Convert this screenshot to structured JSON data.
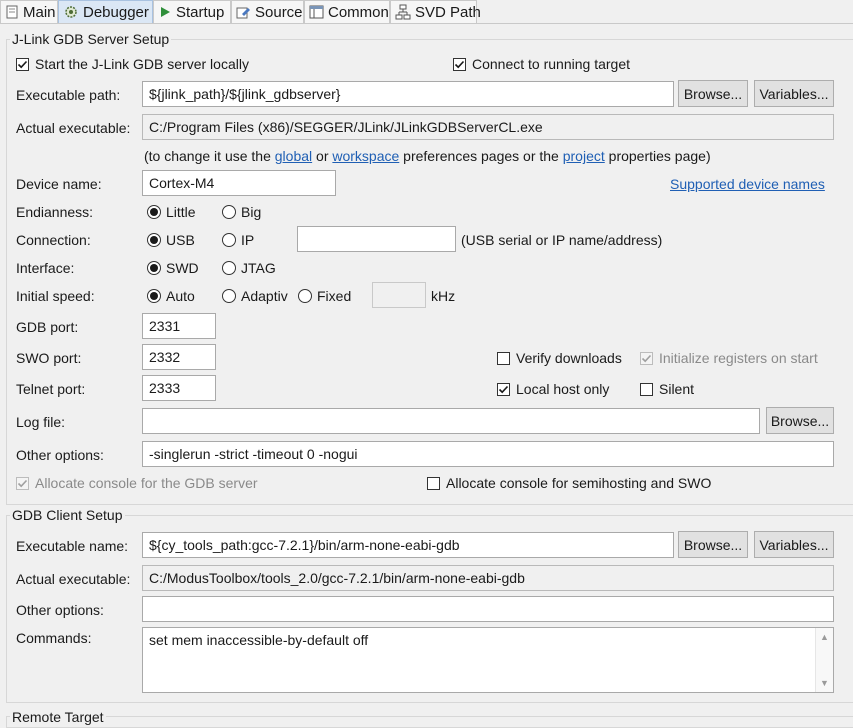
{
  "tabs": [
    {
      "label": "Main",
      "icon": "main-tab-icon",
      "active": false
    },
    {
      "label": "Debugger",
      "icon": "bug-gear-icon",
      "active": true
    },
    {
      "label": "Startup",
      "icon": "play-icon",
      "active": false
    },
    {
      "label": "Source",
      "icon": "source-icon",
      "active": false
    },
    {
      "label": "Common",
      "icon": "common-icon",
      "active": false
    },
    {
      "label": "SVD Path",
      "icon": "svd-icon",
      "active": false
    }
  ],
  "jlink": {
    "title": "J-Link GDB Server Setup",
    "start_locally": {
      "label": "Start the J-Link GDB server locally",
      "checked": true
    },
    "connect_running": {
      "label": "Connect to running target",
      "checked": true
    },
    "exec_path_label": "Executable path:",
    "exec_path_value": "${jlink_path}/${jlink_gdbserver}",
    "browse_label": "Browse...",
    "variables_label": "Variables...",
    "actual_exec_label": "Actual executable:",
    "actual_exec_value": "C:/Program Files (x86)/SEGGER/JLink/JLinkGDBServerCL.exe",
    "hint_prefix": "(to change it use the ",
    "hint_global": "global",
    "hint_or": " or ",
    "hint_workspace": "workspace",
    "hint_mid": " preferences pages or the ",
    "hint_project": "project",
    "hint_suffix": " properties page)",
    "device_label": "Device name:",
    "device_value": "Cortex-M4",
    "supported_link": "Supported device names",
    "endianness_label": "Endianness:",
    "endian_little": "Little",
    "endian_big": "Big",
    "connection_label": "Connection:",
    "conn_usb": "USB",
    "conn_ip": "IP",
    "conn_value": "",
    "conn_hint": "(USB serial or IP name/address)",
    "interface_label": "Interface:",
    "iface_swd": "SWD",
    "iface_jtag": "JTAG",
    "speed_label": "Initial speed:",
    "speed_auto": "Auto",
    "speed_adaptive": "Adaptiv",
    "speed_fixed": "Fixed",
    "speed_value": "",
    "speed_unit": "kHz",
    "gdb_port_label": "GDB port:",
    "gdb_port_value": "2331",
    "swo_port_label": "SWO port:",
    "swo_port_value": "2332",
    "telnet_port_label": "Telnet port:",
    "telnet_port_value": "2333",
    "verify_downloads": {
      "label": "Verify downloads",
      "checked": false
    },
    "init_registers": {
      "label": "Initialize registers on start",
      "checked": true,
      "disabled": true
    },
    "local_host_only": {
      "label": "Local host only",
      "checked": true
    },
    "silent": {
      "label": "Silent",
      "checked": false
    },
    "log_file_label": "Log file:",
    "log_file_value": "",
    "log_browse_label": "Browse...",
    "other_options_label": "Other options:",
    "other_options_value": "-singlerun -strict -timeout 0 -nogui",
    "alloc_console_gdb": {
      "label": "Allocate console for the GDB server",
      "checked": true,
      "disabled": true
    },
    "alloc_console_semi": {
      "label": "Allocate console for semihosting and SWO",
      "checked": false
    }
  },
  "client": {
    "title": "GDB Client Setup",
    "exec_name_label": "Executable name:",
    "exec_name_value": "${cy_tools_path:gcc-7.2.1}/bin/arm-none-eabi-gdb",
    "browse_label": "Browse...",
    "variables_label": "Variables...",
    "actual_exec_label": "Actual executable:",
    "actual_exec_value": "C:/ModusToolbox/tools_2.0/gcc-7.2.1/bin/arm-none-eabi-gdb",
    "other_options_label": "Other options:",
    "other_options_value": "",
    "commands_label": "Commands:",
    "commands_value": "set mem inaccessible-by-default off"
  },
  "remote": {
    "title": "Remote Target"
  }
}
